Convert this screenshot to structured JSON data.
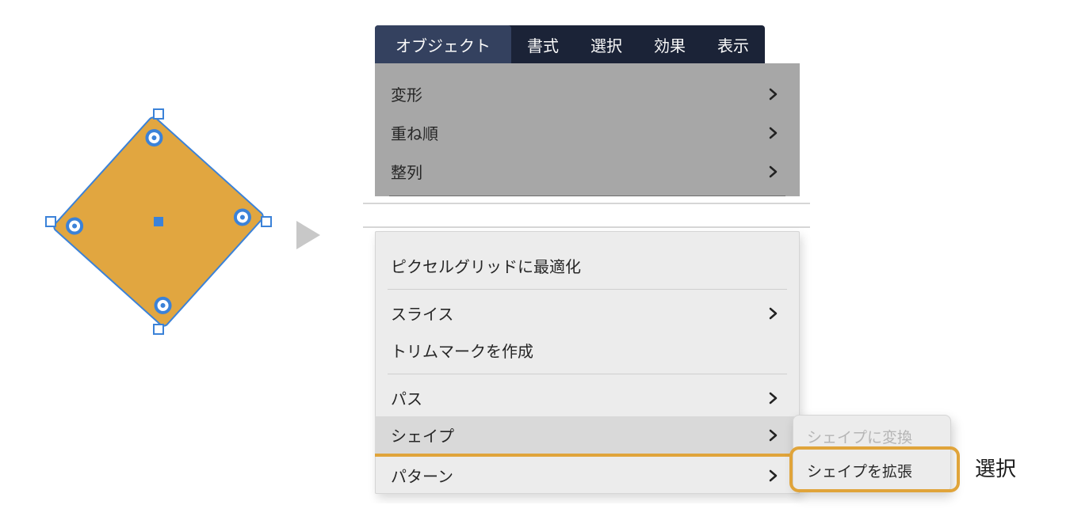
{
  "menubar": {
    "tabs": [
      {
        "label": "オブジェクト",
        "selected": true
      },
      {
        "label": "書式",
        "selected": false
      },
      {
        "label": "選択",
        "selected": false
      },
      {
        "label": "効果",
        "selected": false
      },
      {
        "label": "表示",
        "selected": false
      }
    ]
  },
  "menu_top": {
    "items": [
      {
        "label": "変形",
        "submenu": true
      },
      {
        "label": "重ね順",
        "submenu": true
      },
      {
        "label": "整列",
        "submenu": true
      }
    ]
  },
  "menu_bottom": {
    "items": [
      {
        "label": "ピクセルグリッドに最適化",
        "submenu": false,
        "sep_after": true,
        "highlight": false,
        "orange_underline": false
      },
      {
        "label": "スライス",
        "submenu": true,
        "sep_after": false,
        "highlight": false,
        "orange_underline": false
      },
      {
        "label": "トリムマークを作成",
        "submenu": false,
        "sep_after": true,
        "highlight": false,
        "orange_underline": false
      },
      {
        "label": "パス",
        "submenu": true,
        "sep_after": false,
        "highlight": false,
        "orange_underline": false
      },
      {
        "label": "シェイプ",
        "submenu": true,
        "sep_after": false,
        "highlight": true,
        "orange_underline": true
      },
      {
        "label": "パターン",
        "submenu": true,
        "sep_after": false,
        "highlight": false,
        "orange_underline": false
      }
    ]
  },
  "submenu": {
    "items": [
      {
        "label": "シェイプに変換",
        "disabled": true,
        "highlighted": false
      },
      {
        "label": "シェイプを拡張",
        "disabled": false,
        "highlighted": true
      }
    ]
  },
  "annotation": "選択",
  "shape": {
    "fill": "#e1a640",
    "stroke": "#3b82d8",
    "rotation_deg": 12,
    "handles_color": "#3b82d8",
    "corner_dot_outer": "#3b82d8",
    "corner_dot_inner": "#ffffff"
  }
}
